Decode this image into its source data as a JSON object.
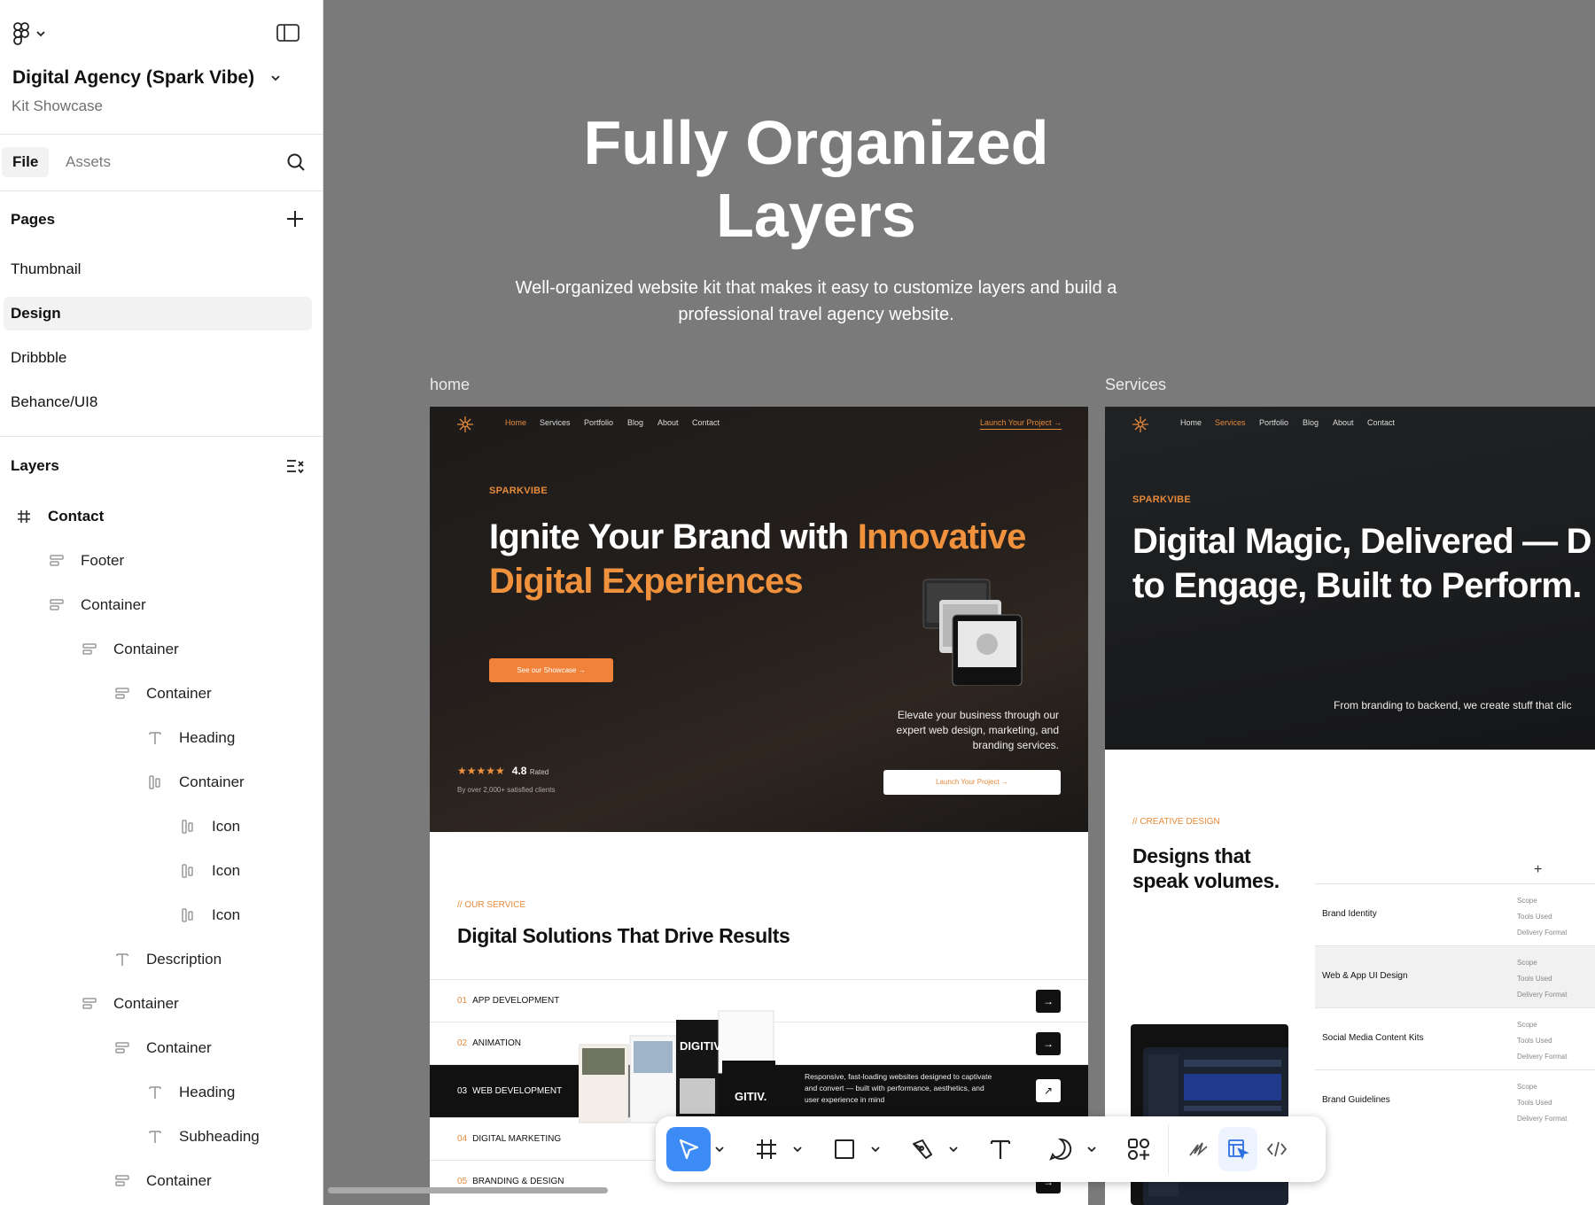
{
  "sidebar": {
    "file_name": "Digital Agency (Spark Vibe)",
    "file_sub": "Kit Showcase",
    "tabs": [
      "File",
      "Assets"
    ],
    "pages_title": "Pages",
    "pages": [
      "Thumbnail",
      "Design",
      "Dribbble",
      "Behance/UI8"
    ],
    "selected_page": "Design",
    "layers_title": "Layers",
    "layers": [
      {
        "label": "Contact",
        "icon": "frame-icon",
        "depth": 0
      },
      {
        "label": "Footer",
        "icon": "auto-layout-icon",
        "depth": 1
      },
      {
        "label": "Container",
        "icon": "auto-layout-icon",
        "depth": 1
      },
      {
        "label": "Container",
        "icon": "auto-layout-icon",
        "depth": 2
      },
      {
        "label": "Container",
        "icon": "auto-layout-icon",
        "depth": 3
      },
      {
        "label": "Heading",
        "icon": "text-icon",
        "depth": 4
      },
      {
        "label": "Container",
        "icon": "auto-layout-horizontal-icon",
        "depth": 4
      },
      {
        "label": "Icon",
        "icon": "auto-layout-horizontal-icon",
        "depth": 5
      },
      {
        "label": "Icon",
        "icon": "auto-layout-horizontal-icon",
        "depth": 5
      },
      {
        "label": "Icon",
        "icon": "auto-layout-horizontal-icon",
        "depth": 5
      },
      {
        "label": "Description",
        "icon": "text-icon",
        "depth": 3
      },
      {
        "label": "Container",
        "icon": "auto-layout-icon",
        "depth": 2
      },
      {
        "label": "Container",
        "icon": "auto-layout-icon",
        "depth": 3
      },
      {
        "label": "Heading",
        "icon": "text-icon",
        "depth": 4
      },
      {
        "label": "Subheading",
        "icon": "text-icon",
        "depth": 4
      },
      {
        "label": "Container",
        "icon": "auto-layout-icon",
        "depth": 3
      }
    ]
  },
  "canvas": {
    "hero_title": "Fully Organized Layers",
    "hero_desc": "Well-organized website kit that makes it easy to customize layers and build a professional travel agency website.",
    "frames": [
      "home",
      "Services"
    ]
  },
  "home": {
    "nav": [
      "Home",
      "Services",
      "Portfolio",
      "Blog",
      "About",
      "Contact"
    ],
    "nav_cta": "Launch Your Project →",
    "kicker": "SPARKVIBE",
    "h1_white": "Ignite Your Brand with ",
    "h1_orange_1": "Innovative",
    "h1_orange_2": "Digital Experiences",
    "showcase_btn": "See our Showcase →",
    "elevate": "Elevate your business through our expert web design, marketing, and branding services.",
    "launch_btn": "Launch Your Project →",
    "stars": "★★★★★",
    "rating": "4.8",
    "rated": "Rated",
    "clients": "By over 2,000+ satisfied clients",
    "svc_kicker": "// OUR SERVICE",
    "svc_title": "Digital Solutions That Drive Results",
    "services": [
      {
        "num": "01",
        "name": "APP DEVELOPMENT"
      },
      {
        "num": "02",
        "name": "ANIMATION"
      },
      {
        "num": "03",
        "name": "WEB DEVELOPMENT"
      },
      {
        "num": "04",
        "name": "DIGITAL MARKETING"
      },
      {
        "num": "05",
        "name": "BRANDING & DESIGN"
      }
    ],
    "web_desc": "Responsive, fast-loading websites designed to captivate and convert — built with performance, aesthetics, and user experience in mind",
    "collage_text_1": "DIGITIV.",
    "collage_text_2": "GITIV."
  },
  "services_page": {
    "nav": [
      "Home",
      "Services",
      "Portfolio",
      "Blog",
      "About",
      "Contact"
    ],
    "kicker": "SPARKVIBE",
    "h1_line1": "Digital Magic, Delivered — D",
    "h1_line2": "to Engage, Built to Perform.",
    "from_text": "From branding to backend, we create stuff that clic",
    "cd_kicker": "// CREATIVE DESIGN",
    "cd_title_1": "Designs that",
    "cd_title_2": "speak volumes.",
    "plus": "+",
    "rows": [
      {
        "name": "Brand Identity"
      },
      {
        "name": "Web & App UI Design"
      },
      {
        "name": "Social Media Content Kits"
      },
      {
        "name": "Brand Guidelines"
      }
    ],
    "row_meta": [
      "Scope",
      "Tools Used",
      "Delivery Format"
    ]
  },
  "toolbar": {
    "tools": [
      "move-tool-icon",
      "frame-tool-icon",
      "rectangle-tool-icon",
      "pen-tool-icon",
      "text-tool-icon",
      "comment-tool-icon",
      "actions-icon",
      "draw-mode-icon",
      "design-mode-icon",
      "dev-mode-icon"
    ]
  },
  "colors": {
    "accent": "#f0913d",
    "blue": "#3d8cf5",
    "canvas": "#7a7a7a"
  }
}
